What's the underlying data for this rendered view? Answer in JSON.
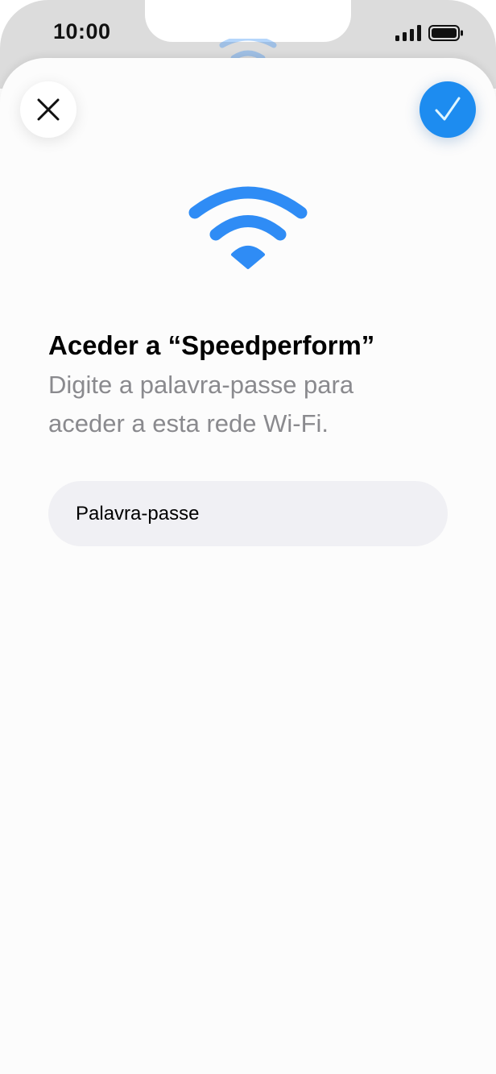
{
  "status_bar": {
    "time": "10:00",
    "signal_icon": "cellular-signal-icon",
    "battery_icon": "battery-icon"
  },
  "sheet": {
    "close_icon": "close-icon",
    "confirm_icon": "checkmark-icon",
    "wifi_icon": "wifi-icon",
    "title": "Aceder a “Speedperform”",
    "subtitle": "Digite a palavra-passe para aceder a esta rede Wi-Fi.",
    "password": {
      "placeholder": "Palavra-passe",
      "value": ""
    }
  },
  "colors": {
    "accent": "#1d8cf0",
    "wifi": "#2f8cf5",
    "subtitle": "#8a8a8e",
    "field_bg": "#f0f0f4"
  }
}
